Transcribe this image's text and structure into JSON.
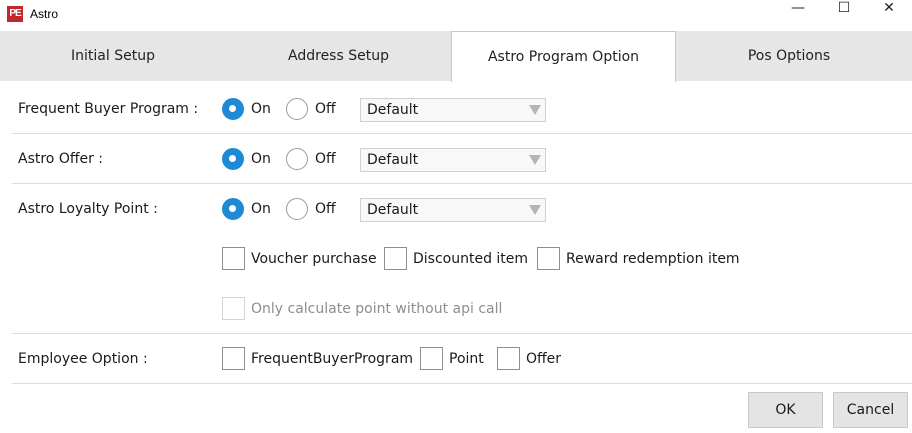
{
  "window": {
    "app_icon": "PE",
    "title": "Astro",
    "minimize": "—",
    "maximize": "☐",
    "close": "✕"
  },
  "tabs": [
    {
      "label": "Initial Setup",
      "active": false
    },
    {
      "label": "Address Setup",
      "active": false
    },
    {
      "label": "Astro Program Option",
      "active": true
    },
    {
      "label": "Pos Options",
      "active": false
    }
  ],
  "rows": {
    "frequent_buyer": {
      "label": "Frequent Buyer Program :",
      "on": "On",
      "off": "Off",
      "selected": "On",
      "select_value": "Default"
    },
    "astro_offer": {
      "label": "Astro Offer :",
      "on": "On",
      "off": "Off",
      "selected": "On",
      "select_value": "Default"
    },
    "loyalty_point": {
      "label": "Astro Loyalty Point :",
      "on": "On",
      "off": "Off",
      "selected": "On",
      "select_value": "Default"
    }
  },
  "loyalty_options": {
    "voucher_purchase": {
      "label": "Voucher purchase",
      "checked": false
    },
    "discounted_item": {
      "label": "Discounted item",
      "checked": false
    },
    "reward_redemption": {
      "label": "Reward redemption item",
      "checked": false
    },
    "calc_without_api": {
      "label": "Only calculate point without api call",
      "checked": false,
      "enabled": false
    }
  },
  "employee_option": {
    "label": "Employee Option :",
    "frequent_buyer": {
      "label": "FrequentBuyerProgram",
      "checked": false
    },
    "point": {
      "label": "Point",
      "checked": false
    },
    "offer": {
      "label": "Offer",
      "checked": false
    }
  },
  "buttons": {
    "ok": "OK",
    "cancel": "Cancel"
  },
  "colors": {
    "accent": "#1e8ad6",
    "tab_bar": "#e6e6e6",
    "app_icon": "#c1272d"
  }
}
